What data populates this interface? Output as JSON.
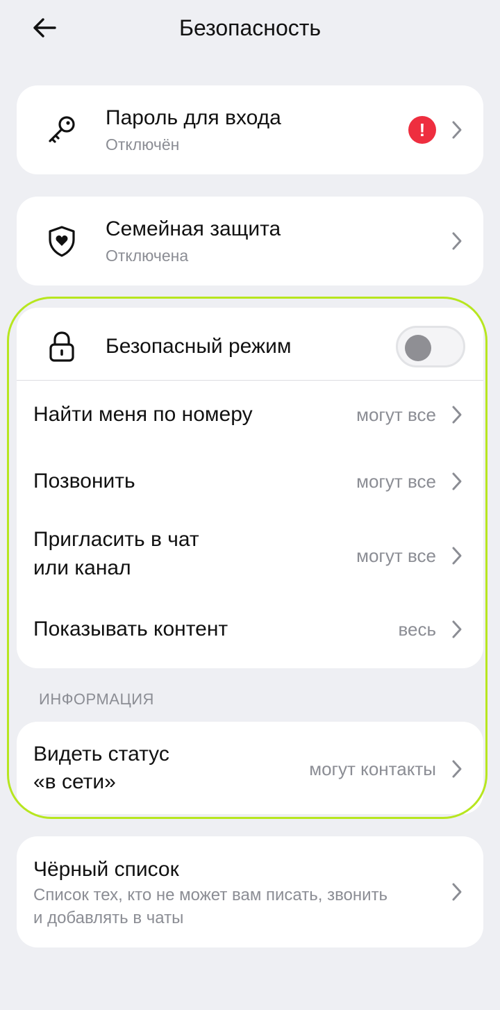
{
  "header": {
    "title": "Безопасность"
  },
  "password": {
    "title": "Пароль для входа",
    "status": "Отключён",
    "alert": "!"
  },
  "family": {
    "title": "Семейная защита",
    "status": "Отключена"
  },
  "safe_mode": {
    "title": "Безопасный режим",
    "enabled": false,
    "rows": [
      {
        "lines": [
          "Найти меня по номеру"
        ],
        "value": "могут все"
      },
      {
        "lines": [
          "Позвонить"
        ],
        "value": "могут все"
      },
      {
        "lines": [
          "Пригласить в чат",
          "или канал"
        ],
        "value": "могут все"
      },
      {
        "lines": [
          "Показывать контент"
        ],
        "value": "весь"
      }
    ]
  },
  "info": {
    "section_label": "ИНФОРМАЦИЯ",
    "online_status": {
      "lines": [
        "Видеть статус",
        "«в сети»"
      ],
      "value": "могут контакты"
    }
  },
  "blacklist": {
    "title": "Чёрный список",
    "description_lines": [
      "Список тех, кто не может вам писать, звонить",
      "и добавлять в чаты"
    ]
  },
  "colors": {
    "background": "#eeeff3",
    "card": "#ffffff",
    "secondary_text": "#8b8d94",
    "alert_red": "#ee2e3f",
    "highlight_outline": "#b7e61f",
    "toggle_knob": "#8f8f94"
  },
  "icons": {
    "back": "arrow-left-icon",
    "password": "key-icon",
    "family": "shield-heart-icon",
    "safe_mode": "lock-icon",
    "chevron": "chevron-right-icon"
  }
}
